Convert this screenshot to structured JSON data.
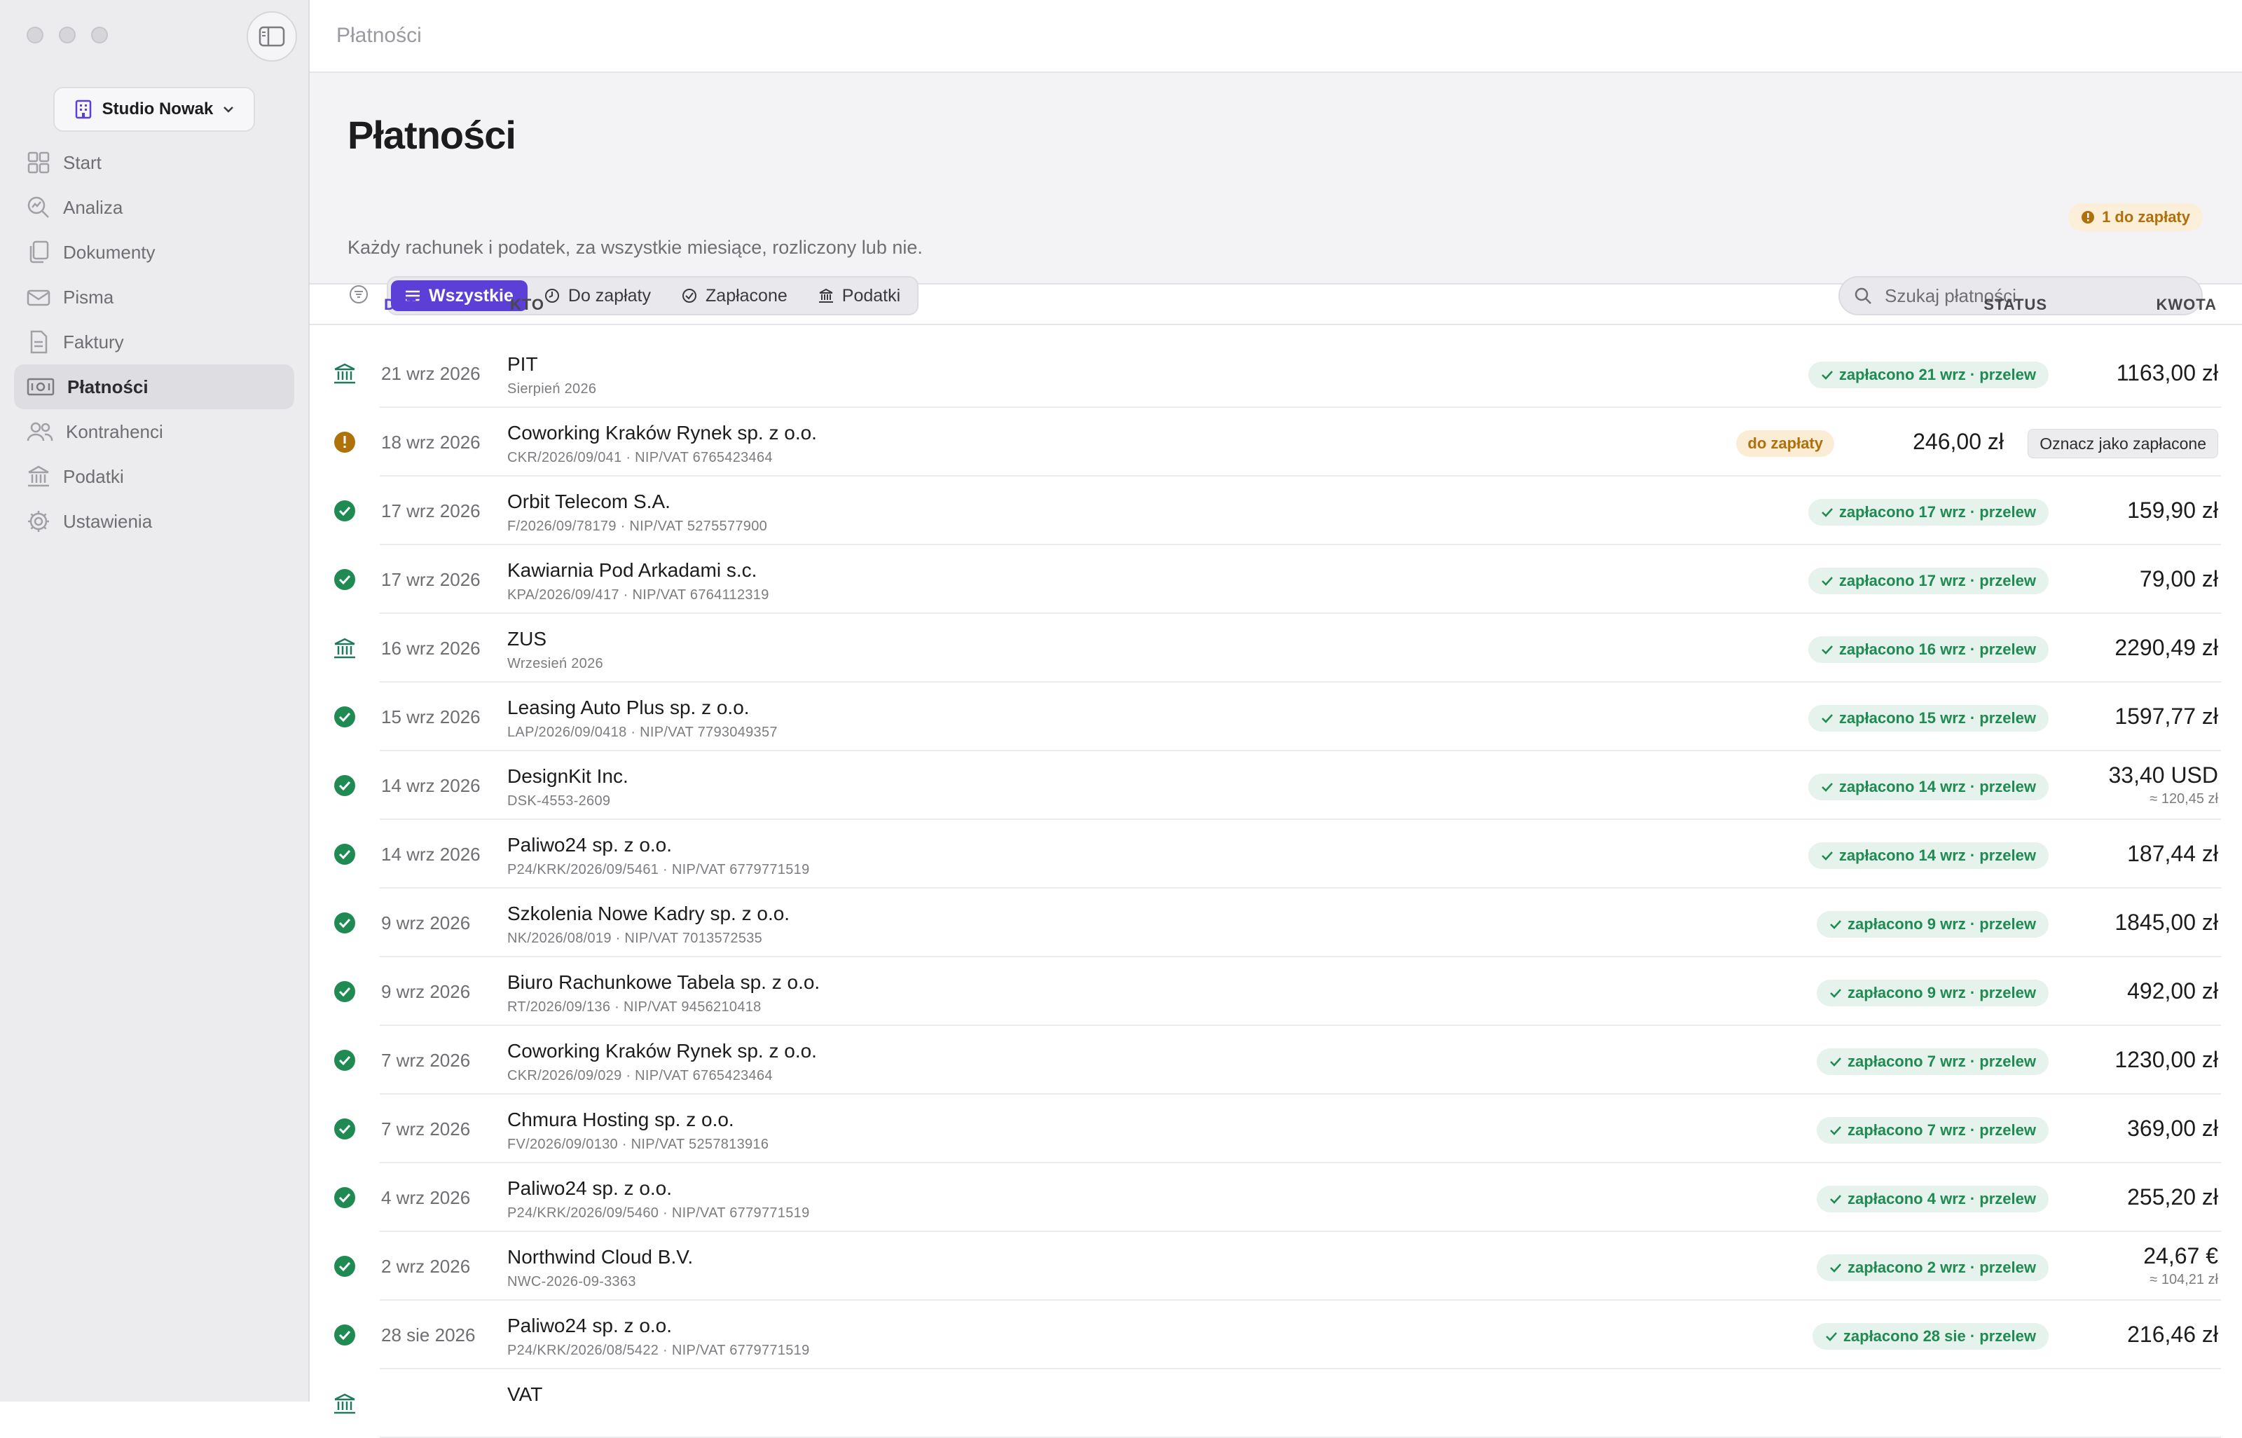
{
  "window": {
    "title": "Płatności"
  },
  "sidebar": {
    "workspace": "Studio Nowak",
    "items": [
      {
        "label": "Start",
        "icon": "grid-icon"
      },
      {
        "label": "Analiza",
        "icon": "magnifier-chart-icon"
      },
      {
        "label": "Dokumenty",
        "icon": "documents-icon"
      },
      {
        "label": "Pisma",
        "icon": "envelope-icon"
      },
      {
        "label": "Faktury",
        "icon": "invoice-icon"
      },
      {
        "label": "Płatności",
        "icon": "payments-icon",
        "active": true
      },
      {
        "label": "Kontrahenci",
        "icon": "people-icon"
      },
      {
        "label": "Podatki",
        "icon": "bank-icon"
      },
      {
        "label": "Ustawienia",
        "icon": "gear-icon"
      }
    ]
  },
  "header": {
    "title": "Płatności",
    "subtitle": "Każdy rachunek i podatek, za wszystkie miesiące, rozliczony lub nie.",
    "pending_badge": "1 do zapłaty",
    "tabs": [
      {
        "label": "Wszystkie",
        "active": true
      },
      {
        "label": "Do zapłaty"
      },
      {
        "label": "Zapłacone"
      },
      {
        "label": "Podatki"
      }
    ],
    "search_placeholder": "Szukaj płatności"
  },
  "table": {
    "columns": {
      "date": "DATA",
      "who": "KTO",
      "status": "STATUS",
      "amount": "KWOTA"
    },
    "mark_paid_label": "Oznacz jako zapłacone",
    "rows": [
      {
        "icon": "tax",
        "date": "21 wrz 2026",
        "name": "PIT",
        "sub": "Sierpień 2026",
        "status": "zapłacono 21 wrz · przelew",
        "amount": "1163,00 zł"
      },
      {
        "icon": "due",
        "date": "18 wrz 2026",
        "name": "Coworking Kraków Rynek sp. z o.o.",
        "sub": "CKR/2026/09/041 · NIP/VAT 6765423464",
        "status": "do zapłaty",
        "amount": "246,00 zł"
      },
      {
        "icon": "paid",
        "date": "17 wrz 2026",
        "name": "Orbit Telecom S.A.",
        "sub": "F/2026/09/78179 · NIP/VAT 5275577900",
        "status": "zapłacono 17 wrz · przelew",
        "amount": "159,90 zł"
      },
      {
        "icon": "paid",
        "date": "17 wrz 2026",
        "name": "Kawiarnia Pod Arkadami s.c.",
        "sub": "KPA/2026/09/417 · NIP/VAT 6764112319",
        "status": "zapłacono 17 wrz · przelew",
        "amount": "79,00 zł"
      },
      {
        "icon": "tax",
        "date": "16 wrz 2026",
        "name": "ZUS",
        "sub": "Wrzesień 2026",
        "status": "zapłacono 16 wrz · przelew",
        "amount": "2290,49 zł"
      },
      {
        "icon": "paid",
        "date": "15 wrz 2026",
        "name": "Leasing Auto Plus sp. z o.o.",
        "sub": "LAP/2026/09/0418 · NIP/VAT 7793049357",
        "status": "zapłacono 15 wrz · przelew",
        "amount": "1597,77 zł"
      },
      {
        "icon": "paid",
        "date": "14 wrz 2026",
        "name": "DesignKit Inc.",
        "sub": "DSK-4553-2609",
        "status": "zapłacono 14 wrz · przelew",
        "amount": "33,40 USD",
        "converted": "≈ 120,45 zł"
      },
      {
        "icon": "paid",
        "date": "14 wrz 2026",
        "name": "Paliwo24 sp. z o.o.",
        "sub": "P24/KRK/2026/09/5461 · NIP/VAT 6779771519",
        "status": "zapłacono 14 wrz · przelew",
        "amount": "187,44 zł"
      },
      {
        "icon": "paid",
        "date": "9 wrz 2026",
        "name": "Szkolenia Nowe Kadry sp. z o.o.",
        "sub": "NK/2026/08/019 · NIP/VAT 7013572535",
        "status": "zapłacono 9 wrz · przelew",
        "amount": "1845,00 zł"
      },
      {
        "icon": "paid",
        "date": "9 wrz 2026",
        "name": "Biuro Rachunkowe Tabela sp. z o.o.",
        "sub": "RT/2026/09/136 · NIP/VAT 9456210418",
        "status": "zapłacono 9 wrz · przelew",
        "amount": "492,00 zł"
      },
      {
        "icon": "paid",
        "date": "7 wrz 2026",
        "name": "Coworking Kraków Rynek sp. z o.o.",
        "sub": "CKR/2026/09/029 · NIP/VAT 6765423464",
        "status": "zapłacono 7 wrz · przelew",
        "amount": "1230,00 zł"
      },
      {
        "icon": "paid",
        "date": "7 wrz 2026",
        "name": "Chmura Hosting sp. z o.o.",
        "sub": "FV/2026/09/0130 · NIP/VAT 5257813916",
        "status": "zapłacono 7 wrz · przelew",
        "amount": "369,00 zł"
      },
      {
        "icon": "paid",
        "date": "4 wrz 2026",
        "name": "Paliwo24 sp. z o.o.",
        "sub": "P24/KRK/2026/09/5460 · NIP/VAT 6779771519",
        "status": "zapłacono 4 wrz · przelew",
        "amount": "255,20 zł"
      },
      {
        "icon": "paid",
        "date": "2 wrz 2026",
        "name": "Northwind Cloud B.V.",
        "sub": "NWC-2026-09-3363",
        "status": "zapłacono 2 wrz · przelew",
        "amount": "24,67 €",
        "converted": "≈ 104,21 zł"
      },
      {
        "icon": "paid",
        "date": "28 sie 2026",
        "name": "Paliwo24 sp. z o.o.",
        "sub": "P24/KRK/2026/08/5422 · NIP/VAT 6779771519",
        "status": "zapłacono 28 sie · przelew",
        "amount": "216,46 zł"
      },
      {
        "icon": "tax",
        "date": "",
        "name": "VAT",
        "sub": "",
        "status": "",
        "amount": ""
      }
    ]
  },
  "colors": {
    "accent": "#5b3fd6",
    "paid_green": "#1f8a52",
    "due_orange": "#b0700a",
    "tax_green": "#1f7a5a"
  }
}
